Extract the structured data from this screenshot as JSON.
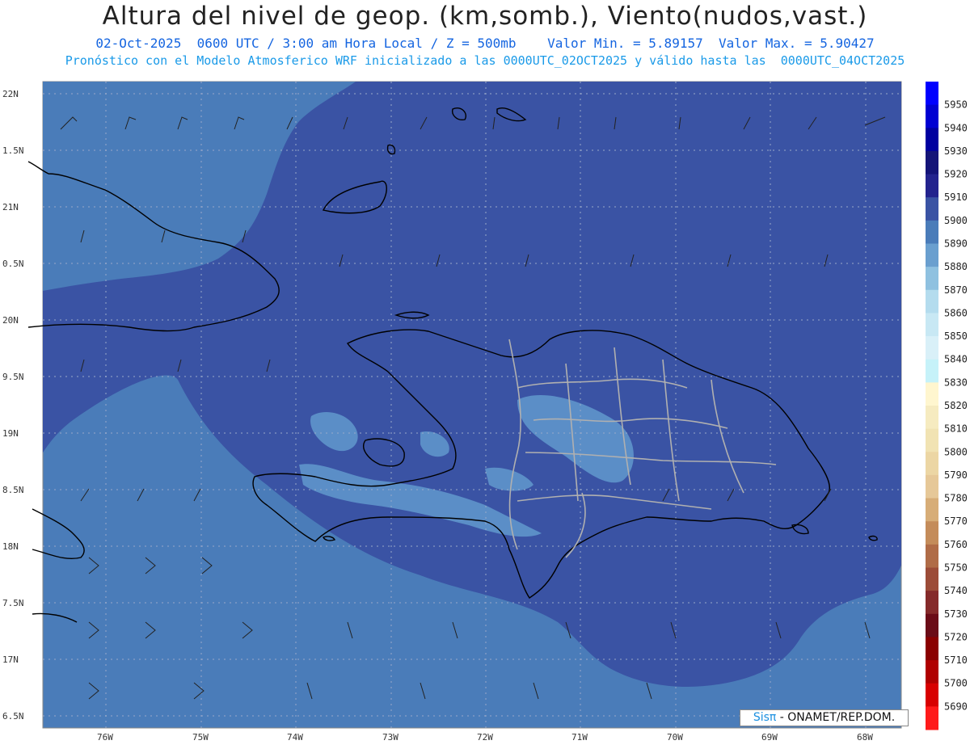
{
  "title": "Altura del nivel de geop. (km,somb.), Viento(nudos,vast.)",
  "subtitle": "02-Oct-2025  0600 UTC / 3:00 am Hora Local / Z = 500mb    Valor Min. = 5.89157  Valor Max. = 5.90427",
  "description": "Pronóstico con el Modelo Atmosferico WRF inicializado a las 0000UTC_02OCT2025 y válido hasta las  0000UTC_04OCT2025",
  "lat_labels": [
    "22N",
    "1.5N",
    "21N",
    "0.5N",
    "20N",
    "9.5N",
    "19N",
    "8.5N",
    "18N",
    "7.5N",
    "17N",
    "6.5N"
  ],
  "lon_labels": [
    "76W",
    "75W",
    "74W",
    "73W",
    "72W",
    "71W",
    "70W",
    "69W",
    "68W"
  ],
  "colorbar": {
    "labels": [
      "5950",
      "5940",
      "5930",
      "5920",
      "5910",
      "5900",
      "5890",
      "5880",
      "5870",
      "5860",
      "5850",
      "5840",
      "5830",
      "5820",
      "5810",
      "5800",
      "5790",
      "5780",
      "5770",
      "5760",
      "5750",
      "5740",
      "5730",
      "5720",
      "5710",
      "5700",
      "5690"
    ],
    "colors": [
      "#0000ff",
      "#0000d2",
      "#0000a0",
      "#141478",
      "#23238e",
      "#3a53a4",
      "#4a7cb9",
      "#6a9fcf",
      "#8fc1e0",
      "#b4dcee",
      "#c8e8f4",
      "#d9f0f8",
      "#c6f2f9",
      "#fff6cf",
      "#f6ebc0",
      "#f1e3b3",
      "#ecd6a4",
      "#e6c898",
      "#d7ad77",
      "#c48c5a",
      "#b06c47",
      "#9c4c38",
      "#852a2a",
      "#6b0c17",
      "#8a0000",
      "#b00000",
      "#d80000",
      "#ff1a1a"
    ]
  },
  "brand": {
    "prefix": "Sisπ",
    "suffix": " - ONAMET/REP.DOM."
  },
  "colors": {
    "deep_field": "#3a53a4",
    "outer_field": "#4a7cb9",
    "light_patch": "#5b8ec7",
    "title_blue": "#1565e0",
    "desc_blue": "#1a9ae8"
  }
}
